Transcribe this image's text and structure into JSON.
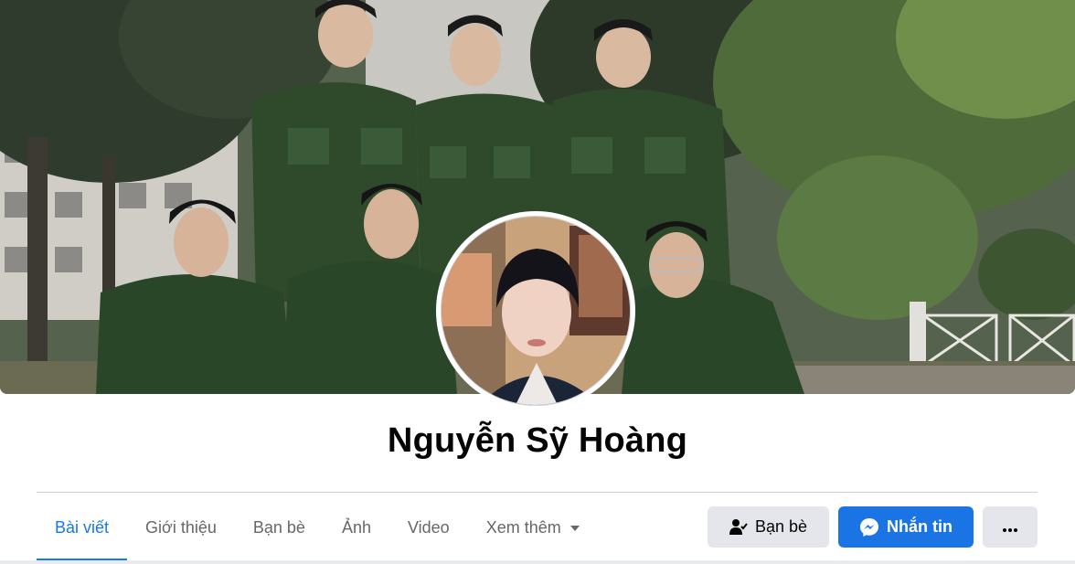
{
  "profile": {
    "name": "Nguyễn Sỹ Hoàng"
  },
  "tabs": [
    {
      "label": "Bài viết",
      "active": true
    },
    {
      "label": "Giới thiệu",
      "active": false
    },
    {
      "label": "Bạn bè",
      "active": false
    },
    {
      "label": "Ảnh",
      "active": false
    },
    {
      "label": "Video",
      "active": false
    },
    {
      "label": "Xem thêm",
      "active": false,
      "icon": "caret-down-icon"
    }
  ],
  "actions": {
    "friends_label": "Bạn bè",
    "friends_icon": "friend-check-icon",
    "message_label": "Nhắn tin",
    "message_icon": "messenger-icon",
    "more_icon": "more-dots-icon"
  },
  "colors": {
    "accent": "#1877f2",
    "message_button": "#1b74e4",
    "secondary_button": "#e4e6eb",
    "muted_text": "#65676b"
  }
}
